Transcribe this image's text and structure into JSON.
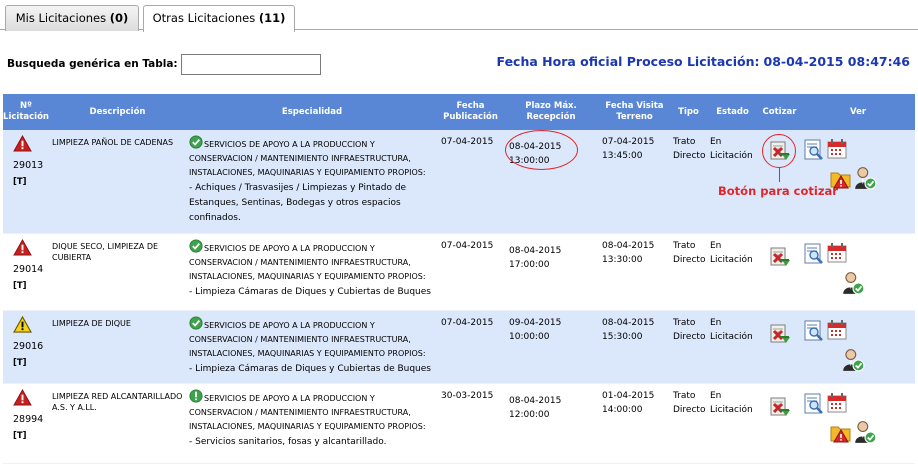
{
  "tabs": [
    {
      "label": "Mis Licitaciones",
      "count": "(0)"
    },
    {
      "label": "Otras Licitaciones",
      "count": "(11)"
    }
  ],
  "search": {
    "label": "Busqueda genérica en Tabla:",
    "value": ""
  },
  "official": {
    "label": "Fecha Hora oficial Proceso Licitación:",
    "value": "08-04-2015 08:47:46"
  },
  "headers": {
    "licitacion": "Nº Licitación",
    "descripcion": "Descripción",
    "especialidad": "Especialidad",
    "publicacion": "Fecha Publicación",
    "plazo": "Plazo Máx. Recepción",
    "visita": "Fecha Visita Terreno",
    "tipo": "Tipo",
    "estado": "Estado",
    "cotizar": "Cotizar",
    "ver": "Ver"
  },
  "annotation": {
    "label": "Botón para cotizar"
  },
  "rows": [
    {
      "number": "29013",
      "tag": "[T]",
      "alert": "red",
      "description": "LIMPIEZA PAÑOL DE CADENAS",
      "specialty": "SERVICIOS DE APOYO A LA PRODUCCION Y CONSERVACION / MANTENIMIENTO INFRAESTRUCTURA, INSTALACIONES, MAQUINARIAS Y EQUIPAMIENTO PROPIOS:",
      "subspecialty": "- Achiques / Trasvasijes / Limpiezas y Pintado de Estanques, Sentinas, Bodegas y otros espacios confinados.",
      "published": "07-04-2015",
      "deadline": "08-04-2015 13:00:00",
      "visit": "07-04-2015 13:45:00",
      "type": "Trato Directo",
      "state": "En Licitación"
    },
    {
      "number": "29014",
      "tag": "[T]",
      "alert": "red",
      "description": "DIQUE SECO, LIMPIEZA DE CUBIERTA",
      "specialty": "SERVICIOS DE APOYO A LA PRODUCCION Y CONSERVACION / MANTENIMIENTO INFRAESTRUCTURA, INSTALACIONES, MAQUINARIAS Y EQUIPAMIENTO PROPIOS:",
      "subspecialty": "- Limpieza Cámaras de Diques y Cubiertas de Buques",
      "published": "07-04-2015",
      "deadline": "08-04-2015 17:00:00",
      "visit": "08-04-2015 13:30:00",
      "type": "Trato Directo",
      "state": "En Licitación"
    },
    {
      "number": "29016",
      "tag": "[T]",
      "alert": "yellow",
      "description": "LIMPIEZA DE DIQUE",
      "specialty": "SERVICIOS DE APOYO A LA PRODUCCION Y CONSERVACION / MANTENIMIENTO INFRAESTRUCTURA, INSTALACIONES, MAQUINARIAS Y EQUIPAMIENTO PROPIOS:",
      "subspecialty": "- Limpieza Cámaras de Diques y Cubiertas de Buques",
      "published": "07-04-2015",
      "deadline": "09-04-2015 10:00:00",
      "visit": "08-04-2015 15:30:00",
      "type": "Trato Directo",
      "state": "En Licitación"
    },
    {
      "number": "28994",
      "tag": "[T]",
      "alert": "red",
      "description": "LIMPIEZA RED ALCANTARILLADO A.S. Y A.LL.",
      "specialty": "SERVICIOS DE APOYO A LA PRODUCCION Y CONSERVACION / MANTENIMIENTO INFRAESTRUCTURA, INSTALACIONES, MAQUINARIAS Y EQUIPAMIENTO PROPIOS:",
      "subspecialty": "- Servicios sanitarios, fosas y alcantarillado.",
      "published": "30-03-2015",
      "deadline": "08-04-2015 12:00:00",
      "visit": "01-04-2015 14:00:00",
      "type": "Trato Directo",
      "state": "En Licitación"
    }
  ]
}
